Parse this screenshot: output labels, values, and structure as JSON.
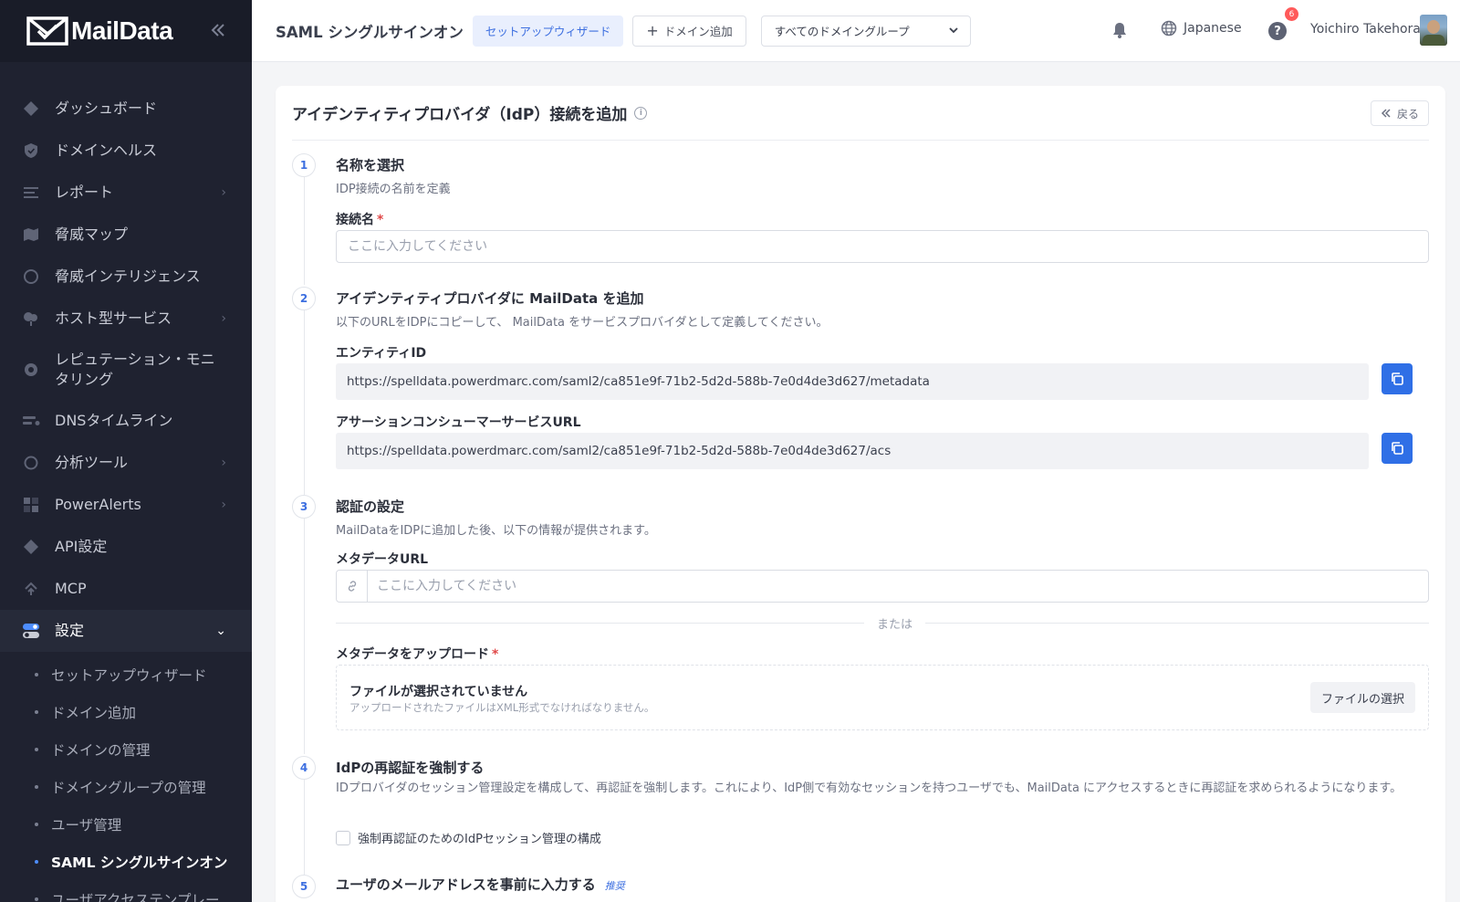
{
  "app": {
    "brand": "MailData"
  },
  "sidebar": {
    "items": [
      {
        "label": "ダッシュボード",
        "icon": "diamond-icon"
      },
      {
        "label": "ドメインヘルス",
        "icon": "shield-icon"
      },
      {
        "label": "レポート",
        "icon": "report-icon",
        "has_children": true
      },
      {
        "label": "脅威マップ",
        "icon": "map-icon"
      },
      {
        "label": "脅威インテリジェンス",
        "icon": "radar-icon"
      },
      {
        "label": "ホスト型サービス",
        "icon": "host-icon",
        "has_children": true
      },
      {
        "label": "レピュテーション・モニタリング",
        "icon": "gear-badge-icon"
      },
      {
        "label": "DNSタイムライン",
        "icon": "timeline-icon"
      },
      {
        "label": "分析ツール",
        "icon": "circle-icon",
        "has_children": true
      },
      {
        "label": "PowerAlerts",
        "icon": "alerts-grid-icon",
        "has_children": true
      },
      {
        "label": "API設定",
        "icon": "diamond-icon"
      },
      {
        "label": "MCP",
        "icon": "mcp-icon"
      },
      {
        "label": "設定",
        "icon": "settings-toggle-icon",
        "expanded": true
      }
    ],
    "settings_sub": [
      "セットアップウィザード",
      "ドメイン追加",
      "ドメインの管理",
      "ドメイングループの管理",
      "ユーザ管理",
      "SAML シングルサインオン",
      "ユーザアクセステンプレー"
    ],
    "current_sub": "SAML シングルサインオン"
  },
  "header": {
    "title": "SAML シングルサインオン",
    "wizard_label": "セットアップウィザード",
    "add_domain_label": "ドメイン追加",
    "domain_group_selected": "すべてのドメイングループ",
    "language": "Japanese",
    "help_badge_count": "6",
    "user_name": "Yoichiro Takehora"
  },
  "card": {
    "title": "アイデンティティプロバイダ（IdP）接続を追加",
    "back_label": "戻る",
    "steps": [
      {
        "num": "1",
        "title": "名称を選択",
        "desc": "IDP接続の名前を定義",
        "field_label": "接続名",
        "placeholder": "ここに入力してください"
      },
      {
        "num": "2",
        "title": "アイデンティティプロバイダに MailData を追加",
        "desc": "以下のURLをIDPにコピーして、 MailData をサービスプロバイダとして定義してください。",
        "entity_label": "エンティティID",
        "entity_value": "https://spelldata.powerdmarc.com/saml2/ca851e9f-71b2-5d2d-588b-7e0d4de3d627/metadata",
        "acs_label": "アサーションコンシューマーサービスURL",
        "acs_value": "https://spelldata.powerdmarc.com/saml2/ca851e9f-71b2-5d2d-588b-7e0d4de3d627/acs"
      },
      {
        "num": "3",
        "title": "認証の設定",
        "desc": "MailDataをIDPに追加した後、以下の情報が提供されます。",
        "metadata_url_label": "メタデータURL",
        "metadata_url_placeholder": "ここに入力してください",
        "or_text": "または",
        "upload_label": "メタデータをアップロード",
        "upload_title": "ファイルが選択されていません",
        "upload_hint": "アップロードされたファイルはXML形式でなければなりません。",
        "file_button": "ファイルの選択"
      },
      {
        "num": "4",
        "title": "IdPの再認証を強制する",
        "desc": "IDプロバイダのセッション管理設定を構成して、再認証を強制します。これにより、IdP側で有効なセッションを持つユーザでも、MailData にアクセスするときに再認証を求められるようになります。",
        "checkbox_label": "強制再認証のためのIdPセッション管理の構成"
      },
      {
        "num": "5",
        "title": "ユーザのメールアドレスを事前に入力する",
        "tag": "推奨"
      }
    ]
  },
  "colors": {
    "sidebar_bg": "#1f2230",
    "accent": "#2f6fe6",
    "badge": "#ff5a5a"
  }
}
